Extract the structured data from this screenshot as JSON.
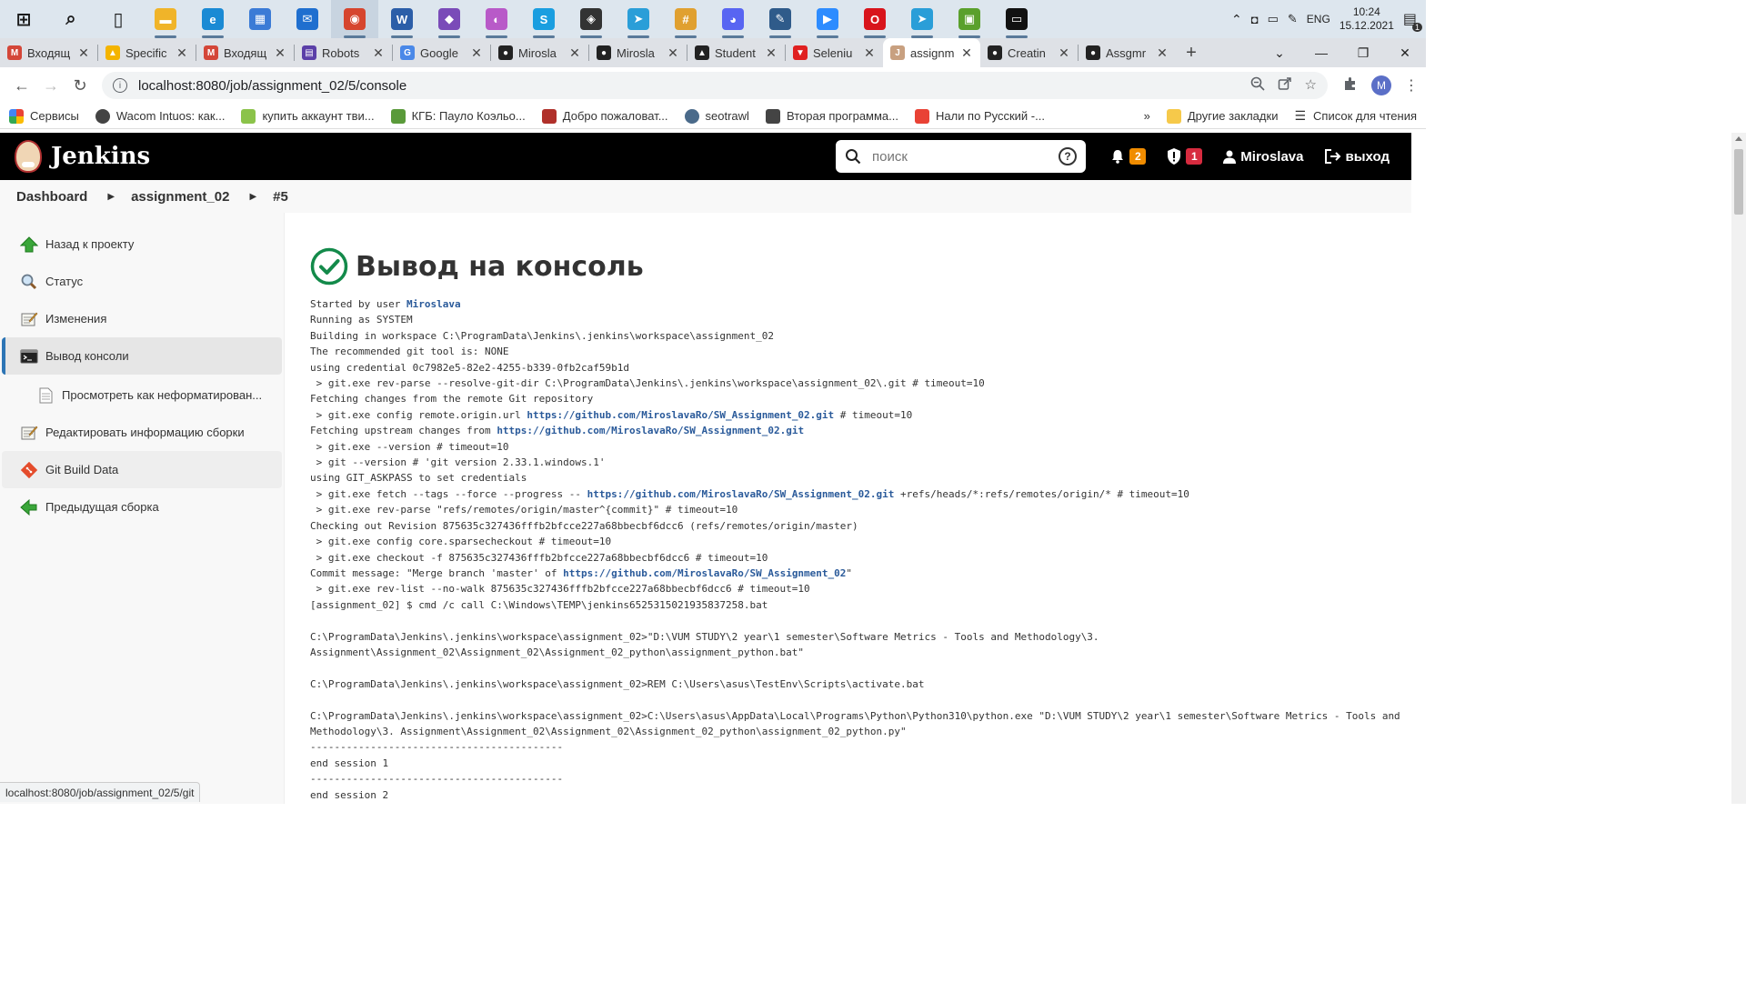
{
  "taskbar": {
    "icons": [
      {
        "name": "windows-start-icon",
        "color": "#1a1a1a"
      },
      {
        "name": "search-icon",
        "color": "#1a1a1a"
      },
      {
        "name": "task-view-icon",
        "color": "#1a1a1a"
      },
      {
        "name": "file-explorer-icon",
        "color": "#f0b429"
      },
      {
        "name": "edge-icon",
        "color": "#1a8ad4"
      },
      {
        "name": "store-icon",
        "color": "#3b7bd6"
      },
      {
        "name": "mail-icon",
        "color": "#1f6fcf"
      },
      {
        "name": "chrome-icon",
        "color": "#d6452e"
      },
      {
        "name": "word-icon",
        "color": "#2b5ea8"
      },
      {
        "name": "visual-studio-icon",
        "color": "#7a4bb8"
      },
      {
        "name": "color-wheel-icon",
        "color": "#b85ac8"
      },
      {
        "name": "skype-icon",
        "color": "#1a9ee0"
      },
      {
        "name": "unity-icon",
        "color": "#333333"
      },
      {
        "name": "telegram-icon",
        "color": "#2a9ed8"
      },
      {
        "name": "slack-icon",
        "color": "#e0a030"
      },
      {
        "name": "discord-icon",
        "color": "#5865f2"
      },
      {
        "name": "drawing-icon",
        "color": "#2f5b8a"
      },
      {
        "name": "zoom-icon",
        "color": "#2d8cff"
      },
      {
        "name": "opera-icon",
        "color": "#d8141b"
      },
      {
        "name": "telegram-badge-icon",
        "color": "#2a9ed8"
      },
      {
        "name": "image-editor-icon",
        "color": "#5aa02c"
      },
      {
        "name": "terminal-icon",
        "color": "#111111"
      }
    ],
    "language": "ENG",
    "time": "10:24",
    "date": "15.12.2021",
    "notifications": "1"
  },
  "tabs": [
    {
      "label": "Входящ",
      "icon": "gmail-icon",
      "color": "#d44638",
      "glyph": "M"
    },
    {
      "label": "Specific",
      "icon": "drive-icon",
      "color": "#f4b400",
      "glyph": "▲"
    },
    {
      "label": "Входящ",
      "icon": "gmail-icon",
      "color": "#d44638",
      "glyph": "M"
    },
    {
      "label": "Robots",
      "icon": "robots-icon",
      "color": "#5b3fa8",
      "glyph": "▤"
    },
    {
      "label": "Google",
      "icon": "translate-icon",
      "color": "#4a88e8",
      "glyph": "G"
    },
    {
      "label": "Mirosla",
      "icon": "github-icon",
      "color": "#222222",
      "glyph": "●"
    },
    {
      "label": "Mirosla",
      "icon": "github-icon",
      "color": "#222222",
      "glyph": "●"
    },
    {
      "label": "Student",
      "icon": "student-icon",
      "color": "#222222",
      "glyph": "▲"
    },
    {
      "label": "Seleniu",
      "icon": "selenium-icon",
      "color": "#e02020",
      "glyph": "▼"
    },
    {
      "label": "assignm",
      "icon": "jenkins-icon",
      "color": "#c8a080",
      "glyph": "J",
      "active": true
    },
    {
      "label": "Creatin",
      "icon": "github-icon",
      "color": "#222222",
      "glyph": "●"
    },
    {
      "label": "Assgmr",
      "icon": "github-icon",
      "color": "#222222",
      "glyph": "●"
    }
  ],
  "address": {
    "url": "localhost:8080/job/assignment_02/5/console",
    "profile_initial": "M"
  },
  "bookmarks": [
    {
      "label": "Сервисы",
      "icon": "apps-grid-icon",
      "color": "#e94235"
    },
    {
      "label": "Wacom Intuos: как...",
      "icon": "wacom-icon",
      "color": "#444444"
    },
    {
      "label": "купить аккаунт тви...",
      "icon": "shield-green-icon",
      "color": "#8bc34a"
    },
    {
      "label": "КГБ: Пауло Коэльо...",
      "icon": "leaf-icon",
      "color": "#5a9a3a"
    },
    {
      "label": "Добро пожаловат...",
      "icon": "quill-icon",
      "color": "#b0302a"
    },
    {
      "label": "seotrawl",
      "icon": "seotrawl-icon",
      "color": "#4a6a8a"
    },
    {
      "label": "Вторая программа...",
      "icon": "shield-outline-icon",
      "color": "#444444"
    },
    {
      "label": "Нали по Русский -...",
      "icon": "colorful-icon",
      "color": "#e94235"
    }
  ],
  "bookmarks_right": {
    "more": "»",
    "other": "Другие закладки",
    "reading": "Список для чтения"
  },
  "jenkins": {
    "title": "Jenkins",
    "search_placeholder": "поиск",
    "notifications_count": "2",
    "security_count": "1",
    "user": "Miroslava",
    "logout": "выход"
  },
  "breadcrumb": [
    "Dashboard",
    "assignment_02",
    "#5"
  ],
  "sidebar": [
    {
      "label": "Назад к проекту",
      "icon": "arrow-up-icon"
    },
    {
      "label": "Статус",
      "icon": "magnifier-icon"
    },
    {
      "label": "Изменения",
      "icon": "notepad-icon"
    },
    {
      "label": "Вывод консоли",
      "icon": "terminal-icon",
      "active": true
    },
    {
      "label": "Просмотреть как неформатирован...",
      "icon": "document-icon",
      "sub": true
    },
    {
      "label": "Редактировать информацию сборки",
      "icon": "notepad-icon"
    },
    {
      "label": "Git Build Data",
      "icon": "git-icon",
      "hover": true
    },
    {
      "label": "Предыдущая сборка",
      "icon": "arrow-left-icon"
    }
  ],
  "main": {
    "title": "Вывод на консоль",
    "console_lines": [
      [
        {
          "t": "Started by user "
        },
        {
          "t": "Miroslava",
          "link": true
        }
      ],
      [
        {
          "t": "Running as SYSTEM"
        }
      ],
      [
        {
          "t": "Building in workspace C:\\ProgramData\\Jenkins\\.jenkins\\workspace\\assignment_02"
        }
      ],
      [
        {
          "t": "The recommended git tool is: NONE"
        }
      ],
      [
        {
          "t": "using credential 0c7982e5-82e2-4255-b339-0fb2caf59b1d"
        }
      ],
      [
        {
          "t": " > git.exe rev-parse --resolve-git-dir C:\\ProgramData\\Jenkins\\.jenkins\\workspace\\assignment_02\\.git # timeout=10"
        }
      ],
      [
        {
          "t": "Fetching changes from the remote Git repository"
        }
      ],
      [
        {
          "t": " > git.exe config remote.origin.url "
        },
        {
          "t": "https://github.com/MiroslavaRo/SW_Assignment_02.git",
          "link": true
        },
        {
          "t": " # timeout=10"
        }
      ],
      [
        {
          "t": "Fetching upstream changes from "
        },
        {
          "t": "https://github.com/MiroslavaRo/SW_Assignment_02.git",
          "link": true
        }
      ],
      [
        {
          "t": " > git.exe --version # timeout=10"
        }
      ],
      [
        {
          "t": " > git --version # 'git version 2.33.1.windows.1'"
        }
      ],
      [
        {
          "t": "using GIT_ASKPASS to set credentials"
        }
      ],
      [
        {
          "t": " > git.exe fetch --tags --force --progress -- "
        },
        {
          "t": "https://github.com/MiroslavaRo/SW_Assignment_02.git",
          "link": true
        },
        {
          "t": " +refs/heads/*:refs/remotes/origin/* # timeout=10"
        }
      ],
      [
        {
          "t": " > git.exe rev-parse \"refs/remotes/origin/master^{commit}\" # timeout=10"
        }
      ],
      [
        {
          "t": "Checking out Revision 875635c327436fffb2bfcce227a68bbecbf6dcc6 (refs/remotes/origin/master)"
        }
      ],
      [
        {
          "t": " > git.exe config core.sparsecheckout # timeout=10"
        }
      ],
      [
        {
          "t": " > git.exe checkout -f 875635c327436fffb2bfcce227a68bbecbf6dcc6 # timeout=10"
        }
      ],
      [
        {
          "t": "Commit message: \"Merge branch 'master' of "
        },
        {
          "t": "https://github.com/MiroslavaRo/SW_Assignment_02",
          "link": true
        },
        {
          "t": "\""
        }
      ],
      [
        {
          "t": " > git.exe rev-list --no-walk 875635c327436fffb2bfcce227a68bbecbf6dcc6 # timeout=10"
        }
      ],
      [
        {
          "t": "[assignment_02] $ cmd /c call C:\\Windows\\TEMP\\jenkins6525315021935837258.bat"
        }
      ],
      [
        {
          "t": ""
        }
      ],
      [
        {
          "t": "C:\\ProgramData\\Jenkins\\.jenkins\\workspace\\assignment_02>\"D:\\VUM STUDY\\2 year\\1 semester\\Software Metrics - Tools and Methodology\\3."
        }
      ],
      [
        {
          "t": "Assignment\\Assignment_02\\Assignment_02\\Assignment_02_python\\assignment_python.bat\""
        }
      ],
      [
        {
          "t": ""
        }
      ],
      [
        {
          "t": "C:\\ProgramData\\Jenkins\\.jenkins\\workspace\\assignment_02>REM C:\\Users\\asus\\TestEnv\\Scripts\\activate.bat"
        }
      ],
      [
        {
          "t": ""
        }
      ],
      [
        {
          "t": "C:\\ProgramData\\Jenkins\\.jenkins\\workspace\\assignment_02>C:\\Users\\asus\\AppData\\Local\\Programs\\Python\\Python310\\python.exe \"D:\\VUM STUDY\\2 year\\1 semester\\Software Metrics - Tools and"
        }
      ],
      [
        {
          "t": "Methodology\\3. Assignment\\Assignment_02\\Assignment_02\\Assignment_02_python\\assignment_02_python.py\""
        }
      ],
      [
        {
          "t": "------------------------------------------"
        }
      ],
      [
        {
          "t": "end session 1"
        }
      ],
      [
        {
          "t": "------------------------------------------"
        }
      ],
      [
        {
          "t": "end session 2"
        }
      ]
    ]
  },
  "statusbar": {
    "url": "localhost:8080/job/assignment_02/5/git"
  }
}
